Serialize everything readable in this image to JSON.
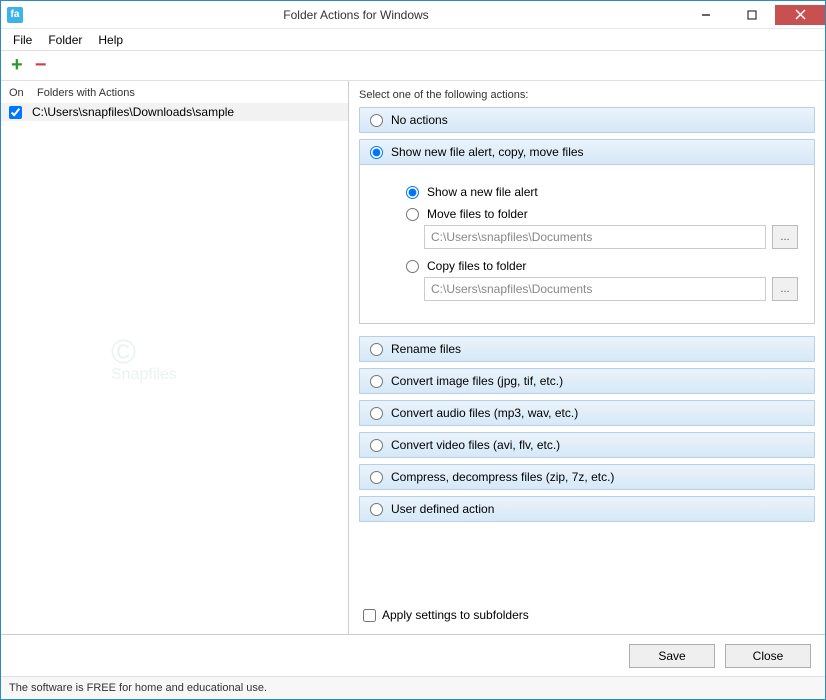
{
  "titlebar": {
    "title": "Folder Actions for Windows",
    "icon_text": "fa"
  },
  "menu": {
    "file": "File",
    "folder": "Folder",
    "help": "Help"
  },
  "toolbar": {
    "add_label": "+",
    "remove_label": "−"
  },
  "left": {
    "col_on": "On",
    "col_folders": "Folders with Actions",
    "rows": [
      {
        "path": "C:\\Users\\snapfiles\\Downloads\\sample",
        "checked": true
      }
    ]
  },
  "right": {
    "title": "Select one of the following actions:",
    "no_actions": "No actions",
    "show_alert_group": "Show new file alert, copy, move files",
    "sub_show_alert": "Show a new file alert",
    "sub_move": "Move files to folder",
    "sub_move_path": "C:\\Users\\snapfiles\\Documents",
    "sub_copy": "Copy files to folder",
    "sub_copy_path": "C:\\Users\\snapfiles\\Documents",
    "browse_label": "...",
    "rename": "Rename files",
    "convert_image": "Convert image files (jpg, tif, etc.)",
    "convert_audio": "Convert audio files (mp3, wav, etc.)",
    "convert_video": "Convert video files (avi, flv, etc.)",
    "compress": "Compress, decompress files (zip, 7z, etc.)",
    "user_defined": "User defined action",
    "apply_subfolders": "Apply settings to subfolders"
  },
  "buttons": {
    "save": "Save",
    "close": "Close"
  },
  "statusbar": "The software is FREE for home and educational use.",
  "watermark": "Snapfiles"
}
